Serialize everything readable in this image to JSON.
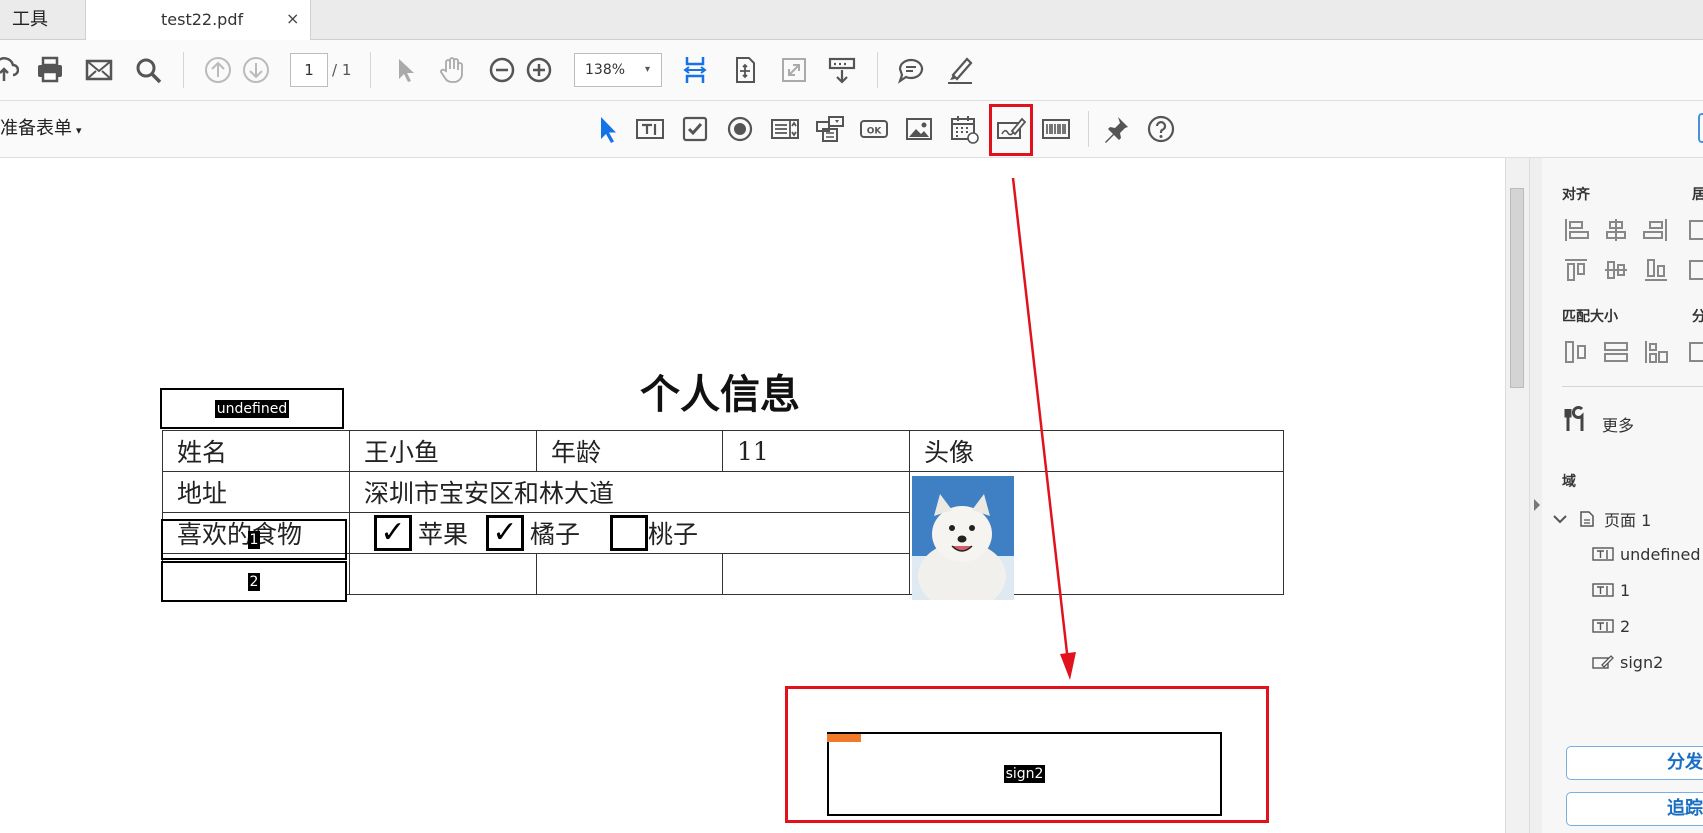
{
  "tabs": {
    "tools_label": "工具",
    "document_label": "test22.pdf",
    "close_glyph": "×"
  },
  "toolbar": {
    "page_current": "1",
    "page_total": "/ 1",
    "zoom": "138%",
    "zoom_caret": "▾",
    "icons": [
      "upload-icon",
      "print-icon",
      "mail-icon",
      "search-icon",
      "page-up-icon",
      "page-down-icon",
      "select-cursor-icon",
      "hand-tool-icon",
      "zoom-out-icon",
      "zoom-in-icon",
      "fit-width-icon",
      "fit-page-icon",
      "full-screen-icon",
      "scroll-mode-icon",
      "comment-icon",
      "highlight-pen-icon"
    ]
  },
  "form_toolbar": {
    "prepare_label": "准备表单",
    "prepare_caret": "▾",
    "tools": [
      "select-object-icon",
      "text-field-icon",
      "checkbox-icon",
      "radio-button-icon",
      "list-box-icon",
      "dropdown-icon",
      "ok-button-icon",
      "image-field-icon",
      "date-field-icon",
      "digital-signature-icon",
      "barcode-icon",
      "pin-icon",
      "help-icon"
    ],
    "ok_text": "OK"
  },
  "document": {
    "title": "个人信息",
    "fields": {
      "undefined_label": "undefined",
      "field1_label": "1",
      "field2_label": "2",
      "sign_label": "sign2"
    },
    "table": {
      "name_label": "姓名",
      "name_value": "王小鱼",
      "age_label": "年龄",
      "age_value": "11",
      "photo_label": "头像",
      "address_label": "地址",
      "address_value": "深圳市宝安区和林大道",
      "food_label": "喜欢的食物",
      "option_apple": "苹果",
      "option_orange": "橘子",
      "option_peach": "桃子",
      "apple_checked": true,
      "orange_checked": true,
      "peach_checked": false,
      "check_glyph": "✓"
    }
  },
  "right_panel": {
    "align_heading": "对齐",
    "align_heading_right": "居",
    "match_size_heading": "匹配大小",
    "match_size_right": "分",
    "more_label": "更多",
    "fields_heading": "域",
    "tree": {
      "page_label": "页面 1",
      "items": [
        "undefined",
        "1",
        "2",
        "sign2"
      ]
    },
    "distribute_button": "分发",
    "track_button": "追踪"
  },
  "colors": {
    "highlight_red": "#e1121b",
    "accent_blue": "#1a6fc4",
    "tool_blue": "#1473e6"
  }
}
